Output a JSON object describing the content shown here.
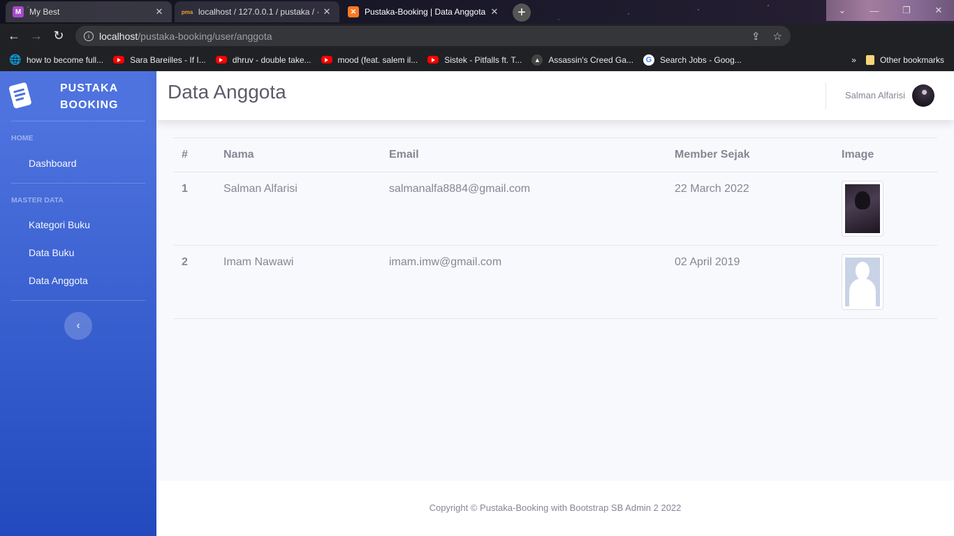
{
  "browser": {
    "tabs": [
      {
        "label": "My Best",
        "icon": "m-icon",
        "color": "#a64ac9"
      },
      {
        "label": "localhost / 127.0.0.1 / pustaka / ·",
        "icon": "phpmyadmin-icon",
        "color": "#f0a030"
      },
      {
        "label": "Pustaka-Booking | Data Anggota",
        "icon": "xampp-icon",
        "color": "#fb7a24"
      }
    ],
    "url_host": "localhost",
    "url_path": "/pustaka-booking/user/anggota",
    "bookmarks": [
      {
        "label": "how to become full...",
        "icon": "globe-icon"
      },
      {
        "label": "Sara Bareilles - If I...",
        "icon": "youtube-icon"
      },
      {
        "label": "dhruv - double take...",
        "icon": "youtube-icon"
      },
      {
        "label": "mood (feat. salem il...",
        "icon": "youtube-icon"
      },
      {
        "label": "Sistek - Pitfalls ft. T...",
        "icon": "youtube-icon"
      },
      {
        "label": "Assassin's Creed Ga...",
        "icon": "assassins-creed-icon"
      },
      {
        "label": "Search Jobs - Goog...",
        "icon": "google-icon"
      }
    ],
    "other_bookmarks": "Other bookmarks"
  },
  "sidebar": {
    "brand_line1": "PUSTAKA",
    "brand_line2": "BOOKING",
    "heading_home": "HOME",
    "item_dashboard": "Dashboard",
    "heading_master": "MASTER DATA",
    "item_kategori": "Kategori Buku",
    "item_buku": "Data Buku",
    "item_anggota": "Data Anggota",
    "accent": "#4e73df"
  },
  "topbar": {
    "title": "Data Anggota",
    "user_name": "Salman Alfarisi"
  },
  "table": {
    "headers": [
      "#",
      "Nama",
      "Email",
      "Member Sejak",
      "Image"
    ],
    "rows": [
      {
        "no": "1",
        "nama": "Salman Alfarisi",
        "email": "salmanalfa8884@gmail.com",
        "since": "22 March 2022",
        "image": "user-photo"
      },
      {
        "no": "2",
        "nama": "Imam Nawawi",
        "email": "imam.imw@gmail.com",
        "since": "02 April 2019",
        "image": "default-avatar"
      }
    ]
  },
  "footer": {
    "copyright": "Copyright © Pustaka-Booking with Bootstrap SB Admin 2 2022"
  }
}
